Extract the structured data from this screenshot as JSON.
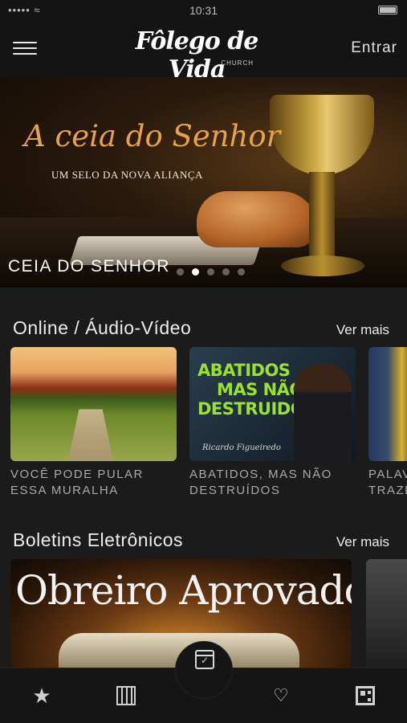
{
  "status_bar": {
    "carrier": "••••• ≈",
    "time": "10:31"
  },
  "header": {
    "logo_script": "Fôlego de Vida",
    "logo_church": "CHURCH",
    "login_label": "Entrar"
  },
  "hero": {
    "title": "A ceia do Senhor",
    "subtitle": "UM SELO DA NOVA ALIANÇA",
    "caption": "CEIA DO SENHOR",
    "slides": 5,
    "active_slide": 2
  },
  "section_online": {
    "title": "Online / Áudio-Vídeo",
    "see_more": "Ver mais",
    "items": [
      {
        "label": "VOCÊ PODE PULAR ESSA MURALHA"
      },
      {
        "label": "ABATIDOS, MAS NÃO DESTRUÍDOS",
        "thumb_words": [
          "ABATIDOS",
          "MAS NÃO",
          "DESTRUIDOS"
        ],
        "thumb_signature": "Ricardo Figueiredo"
      },
      {
        "label": "PALAV... TRAZE..."
      }
    ]
  },
  "section_bulletins": {
    "title": "Boletins Eletrônicos",
    "see_more": "Ver mais",
    "items": [
      {
        "thumb_text": "Obreiro Aprovado"
      }
    ]
  },
  "tabbar": {
    "icons": [
      "star-icon",
      "building-icon",
      "calendar-check-icon",
      "hands-heart-icon",
      "qr-code-icon"
    ]
  },
  "colors": {
    "background": "#1b1b1b",
    "header": "#141414",
    "hero_title": "#e8a24a",
    "thumb_green": "#9be22a"
  }
}
